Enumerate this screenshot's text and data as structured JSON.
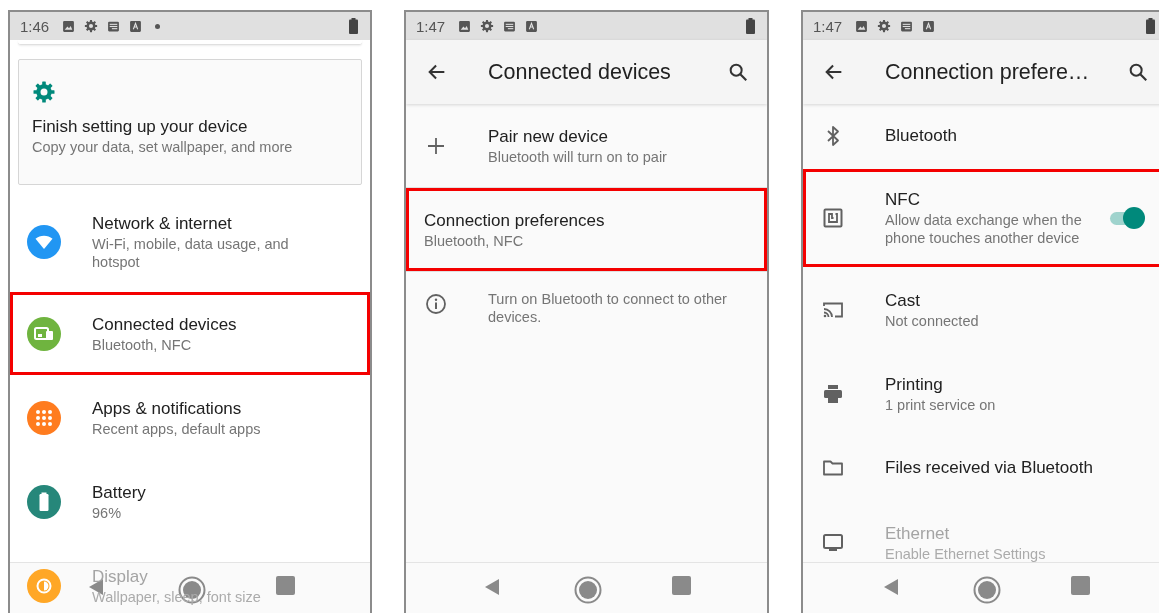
{
  "screens": [
    {
      "status_bar": {
        "time": "1:46",
        "extra_notifications": true
      },
      "suggestion_card": {
        "title": "Finish setting up your device",
        "subtitle": "Copy your data, set wallpaper, and more"
      },
      "items": [
        {
          "kind": "row",
          "title": "Network & internet",
          "subtitle": "Wi-Fi, mobile, data usage, and hotspot",
          "color": "#2196f3",
          "highlighted": false
        },
        {
          "kind": "row",
          "title": "Connected devices",
          "subtitle": "Bluetooth, NFC",
          "color": "#6fb43f",
          "highlighted": true
        },
        {
          "kind": "row",
          "title": "Apps & notifications",
          "subtitle": "Recent apps, default apps",
          "color": "#ff7c1f",
          "highlighted": false
        },
        {
          "kind": "row",
          "title": "Battery",
          "subtitle": "96%",
          "color": "#26877a",
          "highlighted": false
        },
        {
          "kind": "row",
          "title": "Display",
          "subtitle": "Wallpaper, sleep, font size",
          "color": "#ffa726",
          "highlighted": false
        }
      ]
    },
    {
      "status_bar": {
        "time": "1:47",
        "extra_notifications": false
      },
      "app_bar": {
        "title": "Connected devices"
      },
      "items": [
        {
          "kind": "row",
          "title": "Pair new device",
          "subtitle": "Bluetooth will turn on to pair",
          "highlighted": false
        },
        {
          "kind": "row",
          "title": "Connection preferences",
          "subtitle": "Bluetooth, NFC",
          "highlighted": true
        },
        {
          "kind": "note",
          "text": "Turn on Bluetooth to connect to other devices.",
          "highlighted": false
        }
      ]
    },
    {
      "status_bar": {
        "time": "1:47",
        "extra_notifications": false
      },
      "app_bar": {
        "title": "Connection prefere…"
      },
      "items": [
        {
          "kind": "row",
          "title": "Bluetooth",
          "highlighted": false
        },
        {
          "kind": "toggle",
          "title": "NFC",
          "subtitle": "Allow data exchange when the phone touches another device",
          "on": true,
          "highlighted": true
        },
        {
          "kind": "row",
          "title": "Cast",
          "subtitle": "Not connected",
          "highlighted": false
        },
        {
          "kind": "row",
          "title": "Printing",
          "subtitle": "1 print service on",
          "highlighted": false
        },
        {
          "kind": "row",
          "title": "Files received via Bluetooth",
          "highlighted": false
        },
        {
          "kind": "row",
          "title": "Ethernet",
          "subtitle": "Enable Ethernet Settings",
          "highlighted": false
        }
      ]
    }
  ]
}
